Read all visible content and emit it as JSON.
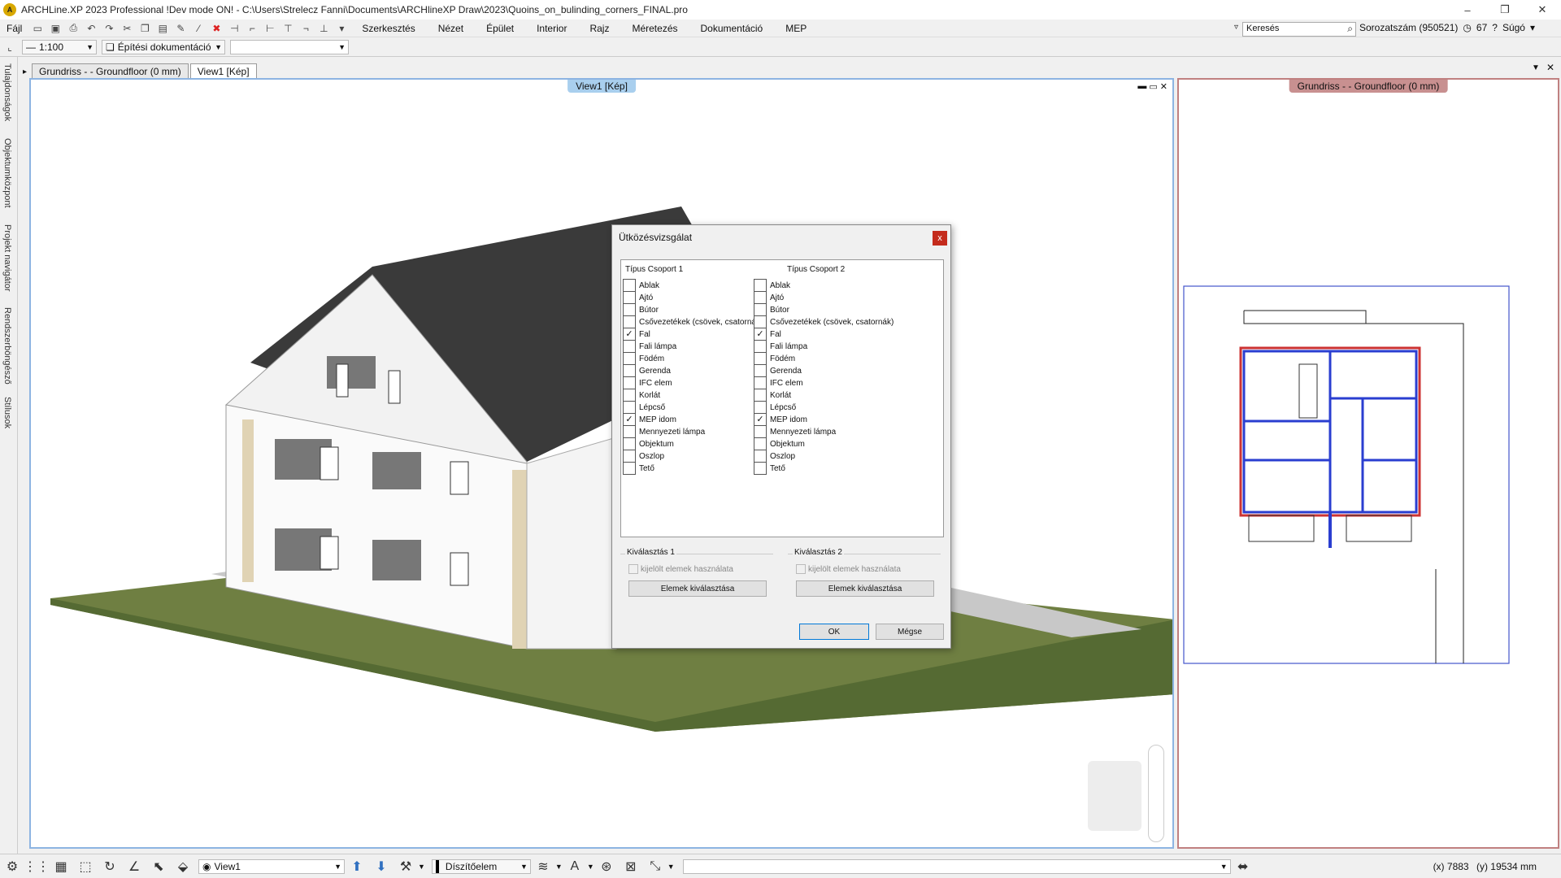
{
  "app": {
    "title": "ARCHLine.XP 2023 Professional !Dev mode ON! - C:\\Users\\Strelecz Fanni\\Documents\\ARCHlineXP Draw\\2023\\Quoins_on_bulinding_corners_FINAL.pro",
    "window_controls": [
      "–",
      "❐",
      "✕"
    ]
  },
  "menu": {
    "items": [
      "Fájl",
      "Szerkesztés",
      "Nézet",
      "Épület",
      "Interior",
      "Rajz",
      "Méretezés",
      "Dokumentáció",
      "MEP"
    ],
    "search_placeholder": "Keresés",
    "serial": "Sorozatszám (950521)",
    "counter": "67",
    "help": "Súgó"
  },
  "toolbar2": {
    "scale": "1:100",
    "layer_set": "Építési dokumentáció"
  },
  "left_panel": {
    "tabs": [
      "Tulajdonságok",
      "Objektumközpont",
      "Projekt navigátor",
      "Rendszerböngésző",
      "Stílusok"
    ]
  },
  "doc_tabs": [
    "Grundriss -  - Groundfloor (0 mm)",
    "View1 [Kép]"
  ],
  "view3d": {
    "label": "View1 [Kép]",
    "label_color": "#a9cfee"
  },
  "view2d": {
    "label": "Grundriss -  - Groundfloor (0 mm)",
    "label_color": "#c89090"
  },
  "dialog": {
    "title": "Ütközésvizsgálat",
    "close": "x",
    "col1_header": "Típus Csoport 1",
    "col2_header": "Típus Csoport 2",
    "items": [
      {
        "label": "Ablak",
        "g1": false,
        "g2": false
      },
      {
        "label": "Ajtó",
        "g1": false,
        "g2": false
      },
      {
        "label": "Bútor",
        "g1": false,
        "g2": false
      },
      {
        "label": "Csővezetékek (csövek, csatornák)",
        "g1": false,
        "g2": false
      },
      {
        "label": "Fal",
        "g1": true,
        "g2": true
      },
      {
        "label": "Fali lámpa",
        "g1": false,
        "g2": false
      },
      {
        "label": "Födém",
        "g1": false,
        "g2": false
      },
      {
        "label": "Gerenda",
        "g1": false,
        "g2": false
      },
      {
        "label": "IFC elem",
        "g1": false,
        "g2": false
      },
      {
        "label": "Korlát",
        "g1": false,
        "g2": false
      },
      {
        "label": "Lépcső",
        "g1": false,
        "g2": false
      },
      {
        "label": "MEP idom",
        "g1": true,
        "g2": true
      },
      {
        "label": "Mennyezeti lámpa",
        "g1": false,
        "g2": false
      },
      {
        "label": "Objektum",
        "g1": false,
        "g2": false
      },
      {
        "label": "Oszlop",
        "g1": false,
        "g2": false
      },
      {
        "label": "Tető",
        "g1": false,
        "g2": false
      }
    ],
    "sel1": {
      "title": "Kiválasztás 1",
      "use_selected": "kijelölt elemek használata",
      "button": "Elemek kiválasztása"
    },
    "sel2": {
      "title": "Kiválasztás 2",
      "use_selected": "kijelölt elemek használata",
      "button": "Elemek kiválasztása"
    },
    "ok": "OK",
    "cancel": "Mégse"
  },
  "statusbar": {
    "view": "View1",
    "style": "Díszítőelem",
    "x_label": "(x)",
    "x": "7883",
    "y_label": "(y)",
    "y": "19534 mm"
  }
}
